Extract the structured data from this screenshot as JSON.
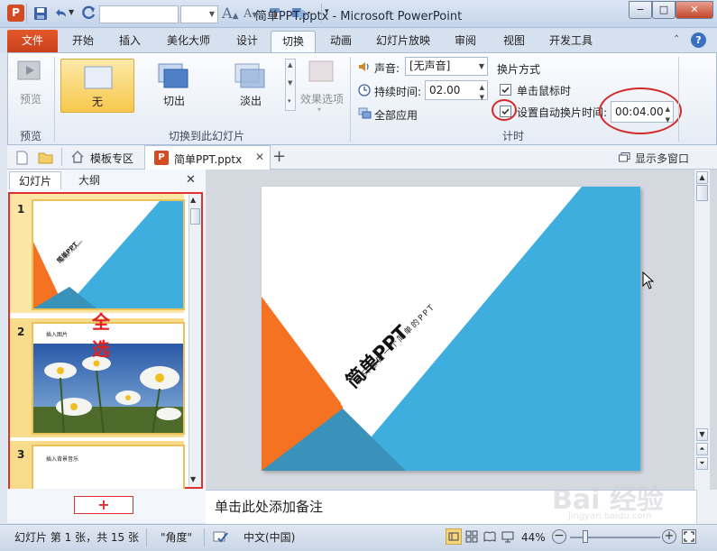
{
  "window": {
    "title": "简单PPT.pptx - Microsoft PowerPoint",
    "controls": {
      "minimize": "−",
      "maximize": "□",
      "close": "✕"
    }
  },
  "quick_access": {
    "font_size_grow": "A",
    "font_size_shrink": "A"
  },
  "tabs": {
    "file": "文件",
    "items": [
      "开始",
      "插入",
      "美化大师",
      "设计",
      "切换",
      "动画",
      "幻灯片放映",
      "审阅",
      "视图",
      "开发工具"
    ],
    "active": "切换"
  },
  "ribbon": {
    "preview_group": {
      "button": "预览",
      "label": "预览"
    },
    "transition_group": {
      "items": [
        "无",
        "切出",
        "淡出"
      ],
      "selected": "无",
      "effects_button": "效果选项",
      "label": "切换到此幻灯片"
    },
    "timing_group": {
      "sound_label": "声音:",
      "sound_value": "[无声音]",
      "duration_label": "持续时间:",
      "duration_value": "02.00",
      "apply_all": "全部应用",
      "advance_title": "换片方式",
      "on_click_label": "单击鼠标时",
      "on_click_checked": true,
      "auto_label": "设置自动换片时间:",
      "auto_checked": true,
      "auto_value": "00:04.00",
      "label": "计时"
    }
  },
  "doc_tabs": {
    "template_zone": "模板专区",
    "current_file": "简单PPT.pptx",
    "close": "✕",
    "add": "+",
    "multi_window": "显示多窗口"
  },
  "left_panel": {
    "tab_slides": "幻灯片",
    "tab_outline": "大纲",
    "close": "✕",
    "annotation": "全选",
    "slides": [
      {
        "number": "1",
        "title": "简单PPT",
        "subtitle": "我只想做一个简单的PPT"
      },
      {
        "number": "2",
        "title": "插入图片"
      },
      {
        "number": "3",
        "title": "插入背景音乐"
      }
    ],
    "add_button": "+"
  },
  "slide": {
    "title": "简单PPT",
    "subtitle": "我只想做一个简单的PPT"
  },
  "notes": {
    "placeholder": "单击此处添加备注"
  },
  "status": {
    "slide_info": "幻灯片 第 1 张，共 15 张",
    "theme": "\"角度\"",
    "language": "中文(中国)",
    "zoom": "44%"
  },
  "watermark": {
    "text": "Bai 经验",
    "sub": "jingyan.baidu.com"
  },
  "colors": {
    "accent_orange": "#f47222",
    "slide_blue": "#3eaede",
    "annotation_red": "#e02020",
    "file_tab": "#d24b22"
  }
}
